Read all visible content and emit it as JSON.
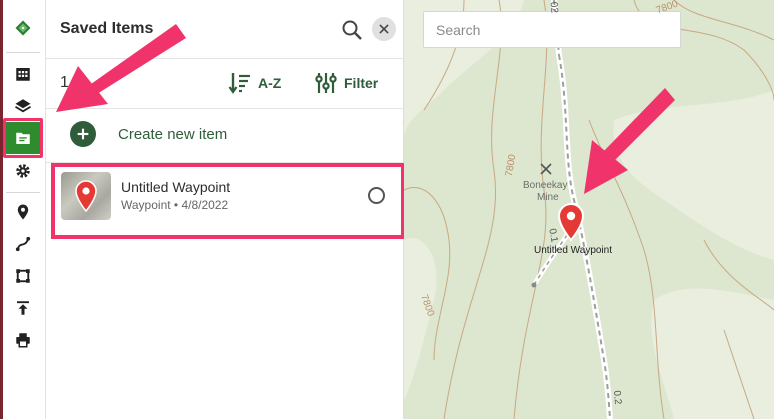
{
  "rail": {
    "items": [
      {
        "name": "logo-icon"
      },
      {
        "name": "calendar-icon"
      },
      {
        "name": "layers-icon"
      },
      {
        "name": "saved-items-folder-icon"
      },
      {
        "name": "settings-gear-icon"
      },
      {
        "name": "waypoint-pin-icon"
      },
      {
        "name": "route-icon"
      },
      {
        "name": "area-icon"
      },
      {
        "name": "upload-icon"
      },
      {
        "name": "print-icon"
      }
    ]
  },
  "panel": {
    "title": "Saved Items",
    "count": "1",
    "sort_label": "A-Z",
    "filter_label": "Filter",
    "create_label": "Create new item",
    "items": [
      {
        "title": "Untitled Waypoint",
        "subtitle": "Waypoint • 4/8/2022"
      }
    ]
  },
  "map": {
    "search_placeholder": "Search",
    "place_label_1": "Boneekay",
    "place_label_2": "Mine",
    "waypoint_label": "Untitled Waypoint",
    "contour_labels": [
      "7800",
      "7800",
      "7800"
    ],
    "trail_labels": [
      "0.1",
      "0.2",
      "02"
    ]
  },
  "colors": {
    "accent_green": "#2f5d3a",
    "active_green": "#2e8b2e",
    "highlight_pink": "#f0346b",
    "pin_red": "#e53935"
  }
}
